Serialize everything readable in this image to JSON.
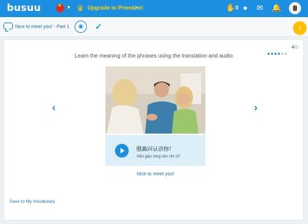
{
  "topbar": {
    "logo_text": "busuu",
    "upgrade_label": "Upgrade to Premium!",
    "notification_count": "0",
    "icons": [
      "flag-cn-icon",
      "crown-icon",
      "hand-icon",
      "friends-icon",
      "mail-icon",
      "bell-icon",
      "avatar"
    ]
  },
  "lesson": {
    "title": "Nice to meet you! - Part 1"
  },
  "progress": {
    "current": "4",
    "separator": "/",
    "total": "6",
    "dots_total": 6,
    "dots_active": 4
  },
  "content": {
    "instruction": "Learn the meaning of the phrases using the translation and audio",
    "chinese": "很高兴认识你！",
    "pinyin": "hěn gāo xìng rèn shí nǐ！",
    "translation": "Nice to meet you!"
  },
  "footer": {
    "save_label": "Save to My Vocabulary"
  },
  "colors": {
    "primary": "#1d8fe0",
    "premium_text": "#ffd400",
    "music_button": "#ffbf00",
    "phrase_bg": "#dceff9"
  }
}
